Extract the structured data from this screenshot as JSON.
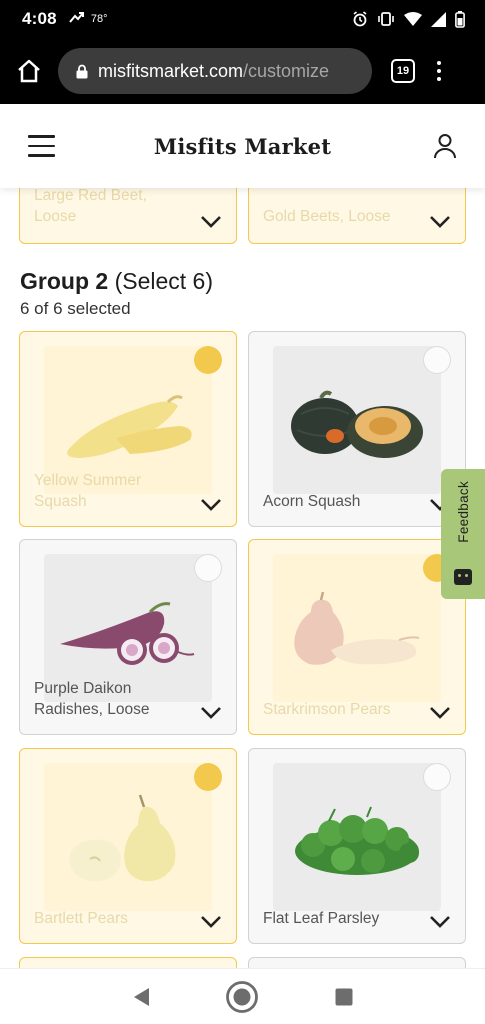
{
  "status_bar": {
    "time": "4:08",
    "temperature": "78°",
    "icons": [
      "missed-call-icon",
      "alarm-icon",
      "vibrate-icon",
      "wifi-icon",
      "signal-icon",
      "battery-icon"
    ]
  },
  "browser": {
    "url_host": "misfitsmarket.com",
    "url_path": "/customize",
    "tab_count": "19"
  },
  "header": {
    "logo": "Misfits Market"
  },
  "group1_tail": [
    {
      "name": "Large Red Beet, Loose",
      "selected": true
    },
    {
      "name": "Gold Beets, Loose",
      "selected": true
    }
  ],
  "group2": {
    "title_bold": "Group 2",
    "title_rest": "(Select 6)",
    "count_text": "6 of 6 selected",
    "items": [
      {
        "name": "Yellow Summer Squash",
        "selected": true
      },
      {
        "name": "Acorn Squash",
        "selected": false
      },
      {
        "name": "Purple Daikon Radishes, Loose",
        "selected": false
      },
      {
        "name": "Starkrimson Pears",
        "selected": true
      },
      {
        "name": "Bartlett Pears",
        "selected": true
      },
      {
        "name": "Flat Leaf Parsley",
        "selected": false
      }
    ]
  },
  "feedback": {
    "label": "Feedback"
  },
  "colors": {
    "selected_border": "#f2c94c",
    "selected_bg": "#fff8e5",
    "feedback_bg": "#a8c779"
  }
}
